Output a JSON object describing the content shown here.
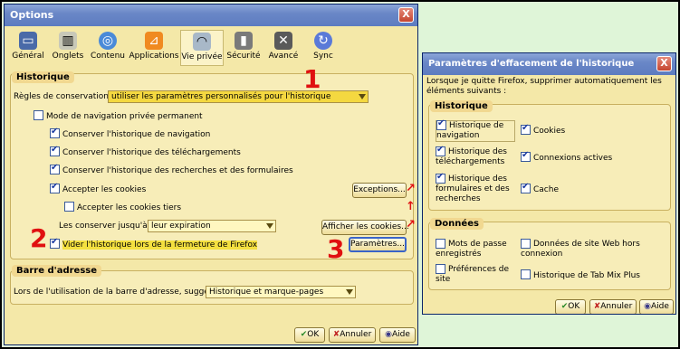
{
  "options_window": {
    "title": "Options",
    "close": "X",
    "tabs": [
      {
        "label": "Général",
        "icon": "computer-icon"
      },
      {
        "label": "Onglets",
        "icon": "tabs-icon"
      },
      {
        "label": "Contenu",
        "icon": "globe-icon"
      },
      {
        "label": "Applications",
        "icon": "rss-icon"
      },
      {
        "label": "Vie privée",
        "icon": "mask-icon"
      },
      {
        "label": "Sécurité",
        "icon": "lock-icon"
      },
      {
        "label": "Avancé",
        "icon": "gear-icon"
      },
      {
        "label": "Sync",
        "icon": "sync-icon"
      }
    ],
    "historique": {
      "title": "Historique",
      "regles_label": "Règles de conservation :",
      "regles_value": "utiliser les paramètres personnalisés pour l'historique",
      "nav_privee": "Mode de navigation privée permanent",
      "conserver_nav": "Conserver l'historique de navigation",
      "conserver_dl": "Conserver l'historique des téléchargements",
      "conserver_rech": "Conserver l'historique des recherches et des formulaires",
      "accepter_cookies": "Accepter les cookies",
      "exceptions_btn": "Exceptions...",
      "cookies_tiers": "Accepter les cookies tiers",
      "conserver_jusqua": "Les conserver jusqu'à :",
      "jusqua_value": "leur expiration",
      "afficher_cookies_btn": "Afficher les cookies...",
      "vider": "Vider l'historique lors de la fermeture de Firefox",
      "parametres_btn": "Paramètres..."
    },
    "barre": {
      "title": "Barre d'adresse",
      "suggest_label": "Lors de l'utilisation de la barre d'adresse, suggérer :",
      "suggest_value": "Historique et marque-pages"
    },
    "ok": "OK",
    "annuler": "Annuler",
    "aide": "Aide"
  },
  "params_window": {
    "title": "Paramètres d'effacement de l'historique",
    "close": "X",
    "intro": "Lorsque je quitte Firefox, supprimer automatiquement les éléments suivants :",
    "historique_title": "Historique",
    "hist_nav": "Historique de navigation",
    "cookies": "Cookies",
    "hist_dl": "Historique des téléchargements",
    "connexions": "Connexions actives",
    "hist_form": "Historique des formulaires et des recherches",
    "cache": "Cache",
    "donnees_title": "Données",
    "mdp": "Mots de passe enregistrés",
    "donnees_site": "Données de site Web hors connexion",
    "prefs_site": "Préférences de site",
    "tabmix": "Historique de Tab Mix Plus",
    "ok": "OK",
    "annuler": "Annuler",
    "aide": "Aide"
  },
  "annotations": {
    "n1": "1",
    "n2": "2",
    "n3": "3"
  }
}
